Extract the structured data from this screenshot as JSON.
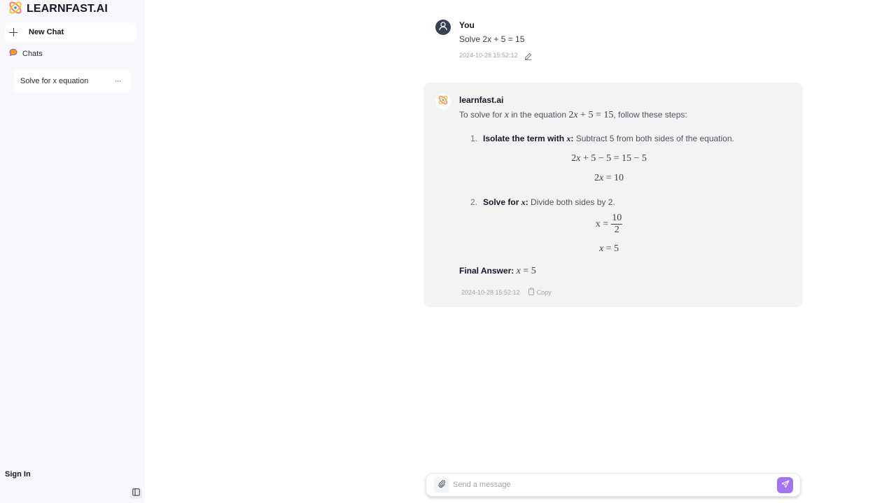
{
  "sidebar": {
    "brand": "LEARNFAST.AI",
    "new_chat_label": "New Chat",
    "chats_label": "Chats",
    "chat_items": [
      {
        "label": "Solve for x equation",
        "more": "···"
      }
    ],
    "sign_in_label": "Sign In"
  },
  "messages": {
    "user": {
      "name": "You",
      "text": "Solve 2x + 5 = 15",
      "timestamp": "2024-10-28 15:52:12"
    },
    "assistant": {
      "name": "learnfast.ai",
      "intro_before": "To solve for ",
      "intro_var": "x",
      "intro_mid": " in the equation ",
      "intro_eq": "2x + 5 = 15",
      "intro_after": ", follow these steps:",
      "steps": [
        {
          "number": "1.",
          "title": "Isolate the term with ",
          "title_var": "x",
          "title_colon": ":",
          "text": " Subtract 5 from both sides of the equation.",
          "equations": [
            "2x + 5 − 5 = 15 − 5",
            "2x = 10"
          ]
        },
        {
          "number": "2.",
          "title": "Solve for ",
          "title_var": "x",
          "title_colon": ":",
          "text": " Divide both sides by 2.",
          "equations": [
            {
              "lhs": "x =",
              "numerator": "10",
              "denominator": "2"
            },
            "x = 5"
          ]
        }
      ],
      "final_label": "Final Answer:",
      "final_value": "x = 5",
      "timestamp": "2024-10-28 15:52:12",
      "copy_label": "Copy"
    }
  },
  "composer": {
    "placeholder": "Send a message",
    "value": ""
  },
  "colors": {
    "accent": "#a274f0",
    "sidebar_bg": "#f8f7fc",
    "assistant_bubble": "#f3f3f3",
    "avatar_user": "#374151"
  }
}
